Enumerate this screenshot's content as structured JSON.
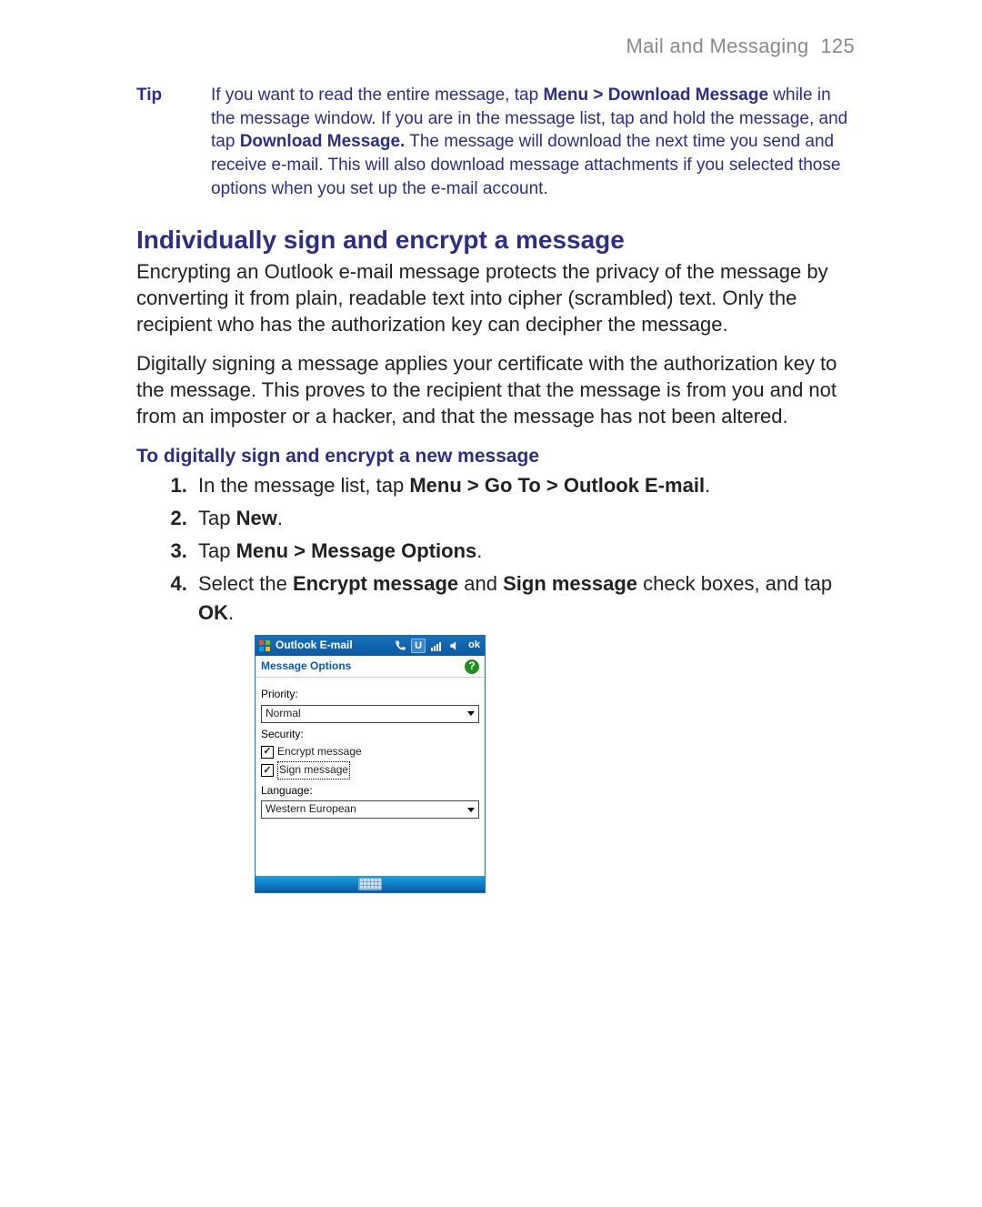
{
  "header": {
    "section": "Mail and Messaging",
    "page_no": "125"
  },
  "tip": {
    "label": "Tip",
    "t1": "If you want to read the entire message, tap ",
    "b1": "Menu > Download Message",
    "t2": " while in the message window. If you are in the message list, tap and hold the message, and tap ",
    "b2": "Download Message.",
    "t3": " The message will download the next time you send and receive e-mail. This will also download message attachments if you selected those options when you set up the e-mail account."
  },
  "heading": "Individually sign and encrypt a message",
  "para1": "Encrypting an Outlook e-mail message protects the privacy of the message by converting it from plain, readable text into cipher (scrambled) text. Only the recipient who has the authorization key can decipher the message.",
  "para2": "Digitally signing a message applies your certificate with the authorization key to the message. This proves to the recipient that the message is from you and not from an imposter or a hacker, and that the message has not been altered.",
  "subhead": "To digitally sign and encrypt a new message",
  "steps": {
    "s1": {
      "t1": "In the message list, tap ",
      "b1": "Menu > Go To > Outlook E-mail",
      "t2": "."
    },
    "s2": {
      "t1": "Tap ",
      "b1": "New",
      "t2": "."
    },
    "s3": {
      "t1": "Tap ",
      "b1": "Menu > Message Options",
      "t2": "."
    },
    "s4": {
      "t1": "Select the ",
      "b1": "Encrypt message",
      "t2": " and ",
      "b2": "Sign message",
      "t3": " check boxes, and tap ",
      "b3": "OK",
      "t4": "."
    }
  },
  "mock": {
    "title": "Outlook E-mail",
    "ok": "ok",
    "u": "U",
    "screen_title": "Message Options",
    "help": "?",
    "priority_label": "Priority:",
    "priority_value": "Normal",
    "security_label": "Security:",
    "encrypt_label": "Encrypt message",
    "sign_label": "Sign message",
    "language_label": "Language:",
    "language_value": "Western European"
  }
}
